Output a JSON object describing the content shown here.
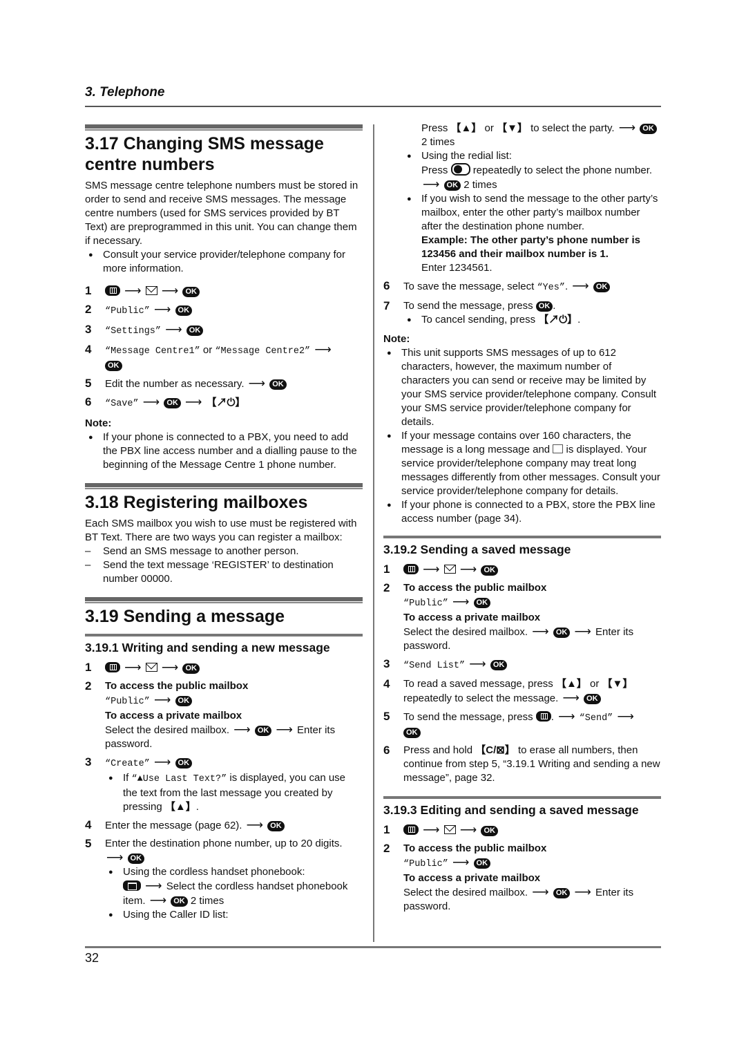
{
  "header": {
    "chapter": "3. Telephone"
  },
  "footer": {
    "page_number": "32"
  },
  "s317": {
    "title_line1": "3.17 Changing SMS message",
    "title_line2": "centre numbers",
    "intro": "SMS message centre telephone numbers must be stored in order to send and receive SMS messages. The message centre numbers (used for SMS services provided by BT Text) are preprogrammed in this unit. You can change them if necessary.",
    "bullet": "Consult your service provider/telephone company for more information.",
    "steps": {
      "s1": "1",
      "s2": "2",
      "s2_text": "“Public”",
      "s3": "3",
      "s3_text": "“Settings”",
      "s4": "4",
      "s4_a": "“Message Centre1”",
      "s4_or": " or ",
      "s4_b": "“Message Centre2”",
      "s5": "5",
      "s5_text": "Edit the number as necessary.",
      "s6": "6",
      "s6_text": "“Save”",
      "s6_key": "【↗⏻】"
    },
    "note_label": "Note:",
    "note": "If your phone is connected to a PBX, you need to add the PBX line access number and a dialling pause to the beginning of the Message Centre 1 phone number."
  },
  "s318": {
    "title": "3.18 Registering mailboxes",
    "intro": "Each SMS mailbox you wish to use must be registered with BT Text. There are two ways you can register a mailbox:",
    "items": [
      "Send an SMS message to another person.",
      "Send the text message ‘REGISTER’ to destination number 00000."
    ]
  },
  "s319": {
    "title": "3.19 Sending a message",
    "s1": {
      "title": "3.19.1 Writing and sending a new message",
      "n1": "1",
      "n2": "2",
      "n3": "3",
      "n4": "4",
      "n5": "5",
      "n6": "6",
      "n7": "7",
      "public_label": "To access the public mailbox",
      "public_cmd": "“Public”",
      "private_label": "To access a private mailbox",
      "private_text_a": "Select the desired mailbox.",
      "private_text_b": "Enter its password.",
      "create_cmd": "“Create”",
      "create_bullet_a": "If ",
      "create_bullet_cmd": "“▲Use Last Text?”",
      "create_bullet_b": " is displayed, you can use the text from the last message you created by pressing ",
      "create_bullet_key": "【▲】",
      "step4": "Enter the message (page 62).",
      "step5": "Enter the destination phone number, up to 20 digits.",
      "phonebook_label": "Using the cordless handset phonebook:",
      "phonebook_text": "Select the cordless handset phonebook item.",
      "times2": "2 times",
      "callerid_label": "Using the Caller ID list:",
      "callerid_text_a": "Press ",
      "key_up": "【▲】",
      "or": " or ",
      "key_down": "【▼】",
      "callerid_text_b": " to select the party.",
      "callerid_times": "2 times",
      "redial_label": "Using the redial list:",
      "redial_text_a": "Press",
      "redial_text_b": "repeatedly to select the phone number.",
      "mailbox_text": "If you wish to send the message to the other party’s mailbox, enter the other party’s mailbox number after the destination phone number.",
      "example": "Example: The other party’s phone number is 123456 and their mailbox number is 1.",
      "example_enter": "Enter 1234561.",
      "step6_a": "To save the message, select ",
      "step6_cmd": "“Yes”",
      "step7": "To send the message, press",
      "cancel_a": "To cancel sending, press ",
      "cancel_key": "【↗⏻】",
      "note_label": "Note:",
      "notes": [
        "This unit supports SMS messages of up to 612 characters, however, the maximum number of characters you can send or receive may be limited by your SMS service provider/telephone company. Consult your SMS service provider/telephone company for details.",
        "If your message contains over 160 characters, the message is a long message and",
        "is displayed. Your service provider/telephone company may treat long messages differently from other messages. Consult your service provider/telephone company for details.",
        "If your phone is connected to a PBX, store the PBX line access number (page 34)."
      ]
    },
    "s2": {
      "title": "3.19.2 Sending a saved message",
      "n1": "1",
      "n2": "2",
      "n3": "3",
      "n4": "4",
      "n5": "5",
      "n6": "6",
      "public_label": "To access the public mailbox",
      "public_cmd": "“Public”",
      "private_label": "To access a private mailbox",
      "private_text_a": "Select the desired mailbox.",
      "private_text_b": "Enter its password.",
      "sendlist_cmd": "“Send List”",
      "step4_a": "To read a saved message, press ",
      "key_up": "【▲】",
      "or": " or ",
      "key_down": "【▼】",
      "step4_b": " repeatedly to select the message.",
      "step5_a": "To send the message, press",
      "step5_cmd": "“Send”",
      "step6_a": "Press and hold ",
      "step6_key": "【C/⊠】",
      "step6_b": " to erase all numbers, then continue from step 5, “3.19.1 Writing and sending a new message”, page 32."
    },
    "s3": {
      "title": "3.19.3 Editing and sending a saved message",
      "n1": "1",
      "n2": "2",
      "public_label": "To access the public mailbox",
      "public_cmd": "“Public”",
      "private_label": "To access a private mailbox",
      "private_text_a": "Select the desired mailbox.",
      "private_text_b": "Enter its password."
    }
  },
  "icons": {
    "ok": "OK",
    "arrow": "⟶"
  }
}
